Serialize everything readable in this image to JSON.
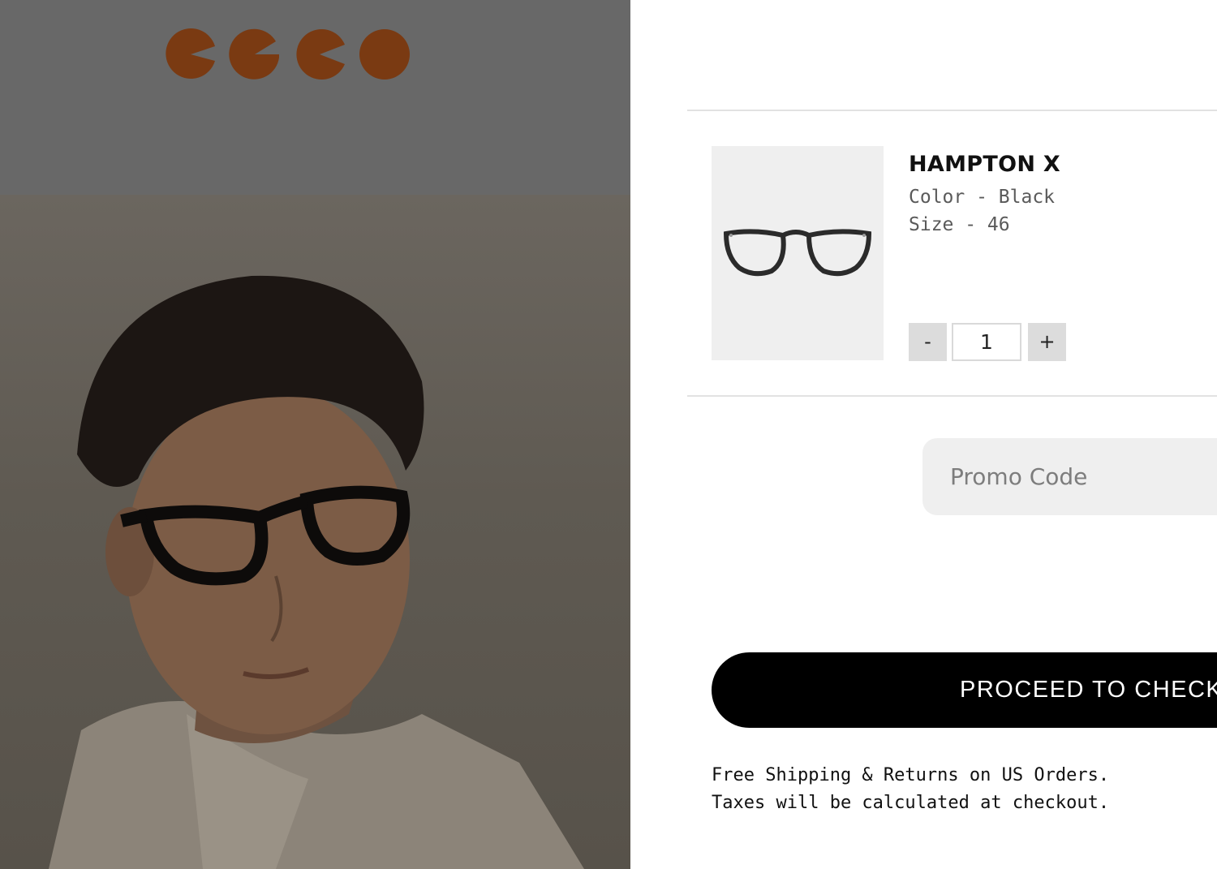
{
  "brand": {
    "logo_alt": "brand logo",
    "logo_color": "#7a3a12"
  },
  "cart": {
    "item": {
      "name": "HAMPTON X",
      "color_line": "Color - Black",
      "size_line": "Size - 46",
      "quantity": "1",
      "minus_label": "-",
      "plus_label": "+"
    },
    "promo": {
      "placeholder": "Promo Code"
    },
    "checkout_label": "PROCEED TO CHECKOUT",
    "notes": {
      "shipping": "Free Shipping & Returns on US Orders.",
      "taxes": "Taxes will be calculated at checkout."
    }
  },
  "colors": {
    "overlay_header": "#686868",
    "button_bg": "#000000",
    "thumb_bg": "#efefef",
    "qty_btn_bg": "#dcdcdc"
  }
}
